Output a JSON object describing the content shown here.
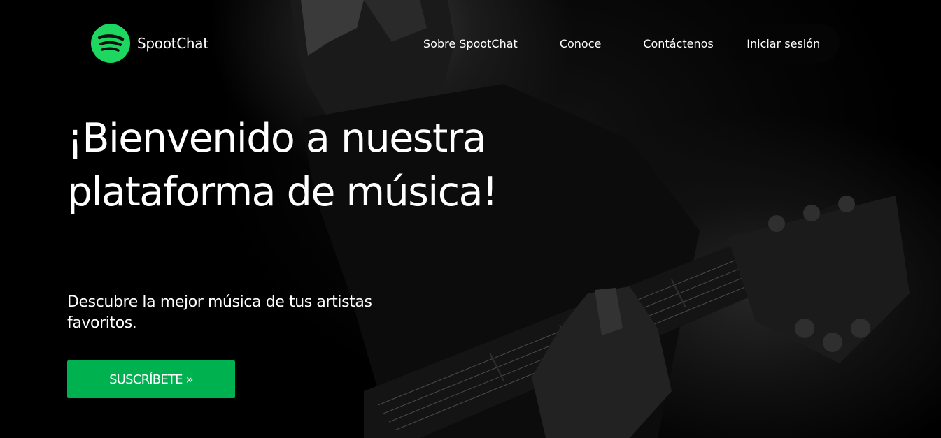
{
  "brand": {
    "name": "SpootChat",
    "logo_icon": "spotify-style-logo-icon",
    "accent_color": "#1ed760"
  },
  "nav": {
    "items": [
      {
        "label": "Sobre SpootChat"
      },
      {
        "label": "Conoce"
      },
      {
        "label": "Contáctenos"
      }
    ],
    "login_label": "Iniciar sesión"
  },
  "hero": {
    "headline": "¡Bienvenido a nuestra plataforma de música!",
    "subheadline": "Descubre la mejor música de tus artistas favoritos.",
    "cta_label": "SUSCRÍBETE »",
    "cta_color": "#00b14f",
    "background_image": "guitarist-photo"
  }
}
